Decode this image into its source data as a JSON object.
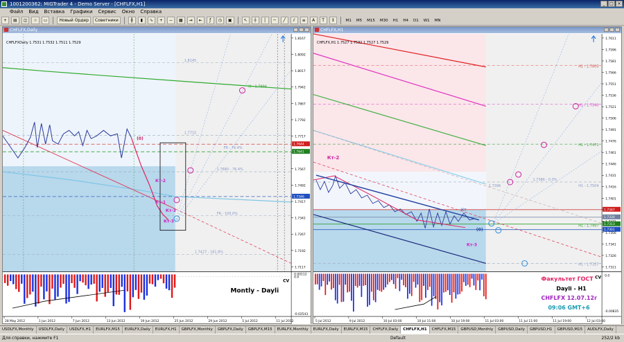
{
  "app": {
    "title": "1001200362: MIGTrader 4 - Demo Server - [CHFLFX,H1]"
  },
  "menu": [
    "Файл",
    "Вид",
    "Вставка",
    "Графики",
    "Сервис",
    "Окно",
    "Справка"
  ],
  "toolbar": {
    "new_order": "Новый Ордер",
    "advisors": "Советники",
    "timeframes": [
      "M1",
      "M5",
      "M15",
      "M30",
      "H1",
      "H4",
      "D1",
      "W1",
      "MN"
    ]
  },
  "left_chart": {
    "window_title": "CHFLFX,Daily",
    "ohlc": "CHFLFXDaily 1.7531 1.7532 1.7511 1.7529",
    "price_ticks": [
      "1.8167",
      "1.8092",
      "1.8017",
      "1.7942",
      "1.7867",
      "1.7792",
      "1.7717",
      "1.7642",
      "1.7567",
      "1.7492",
      "1.7417",
      "1.7342",
      "1.7267",
      "1.7192",
      "1.7117"
    ],
    "indicator_ticks": [
      "0.00112",
      "0.0",
      "-0.02543"
    ],
    "date_ticks": [
      "28 May 2012",
      "1 Jun 2012",
      "7 Jun 2012",
      "13 Jun 2012",
      "19 Jun 2012",
      "25 Jun 2012",
      "29 Jun 2012",
      "5 Jul 2012",
      "11 Jul 2012"
    ],
    "labels": {
      "kt2": "Кт-2",
      "kt1": "Кт-1",
      "kt3": "Кт-3",
      "kt3b": "Кт-3",
      "zero": "(0)",
      "panel_text": "Montly - Dayli",
      "cv": "CV"
    },
    "level_labels": [
      "1.8145",
      "1.7715",
      "FR - 76.4%",
      "1.7680 - 76.4%",
      "FR - 100.0%",
      "1.7427 - 161.8%",
      "HI - 1.7894"
    ],
    "price_tags": [
      {
        "value": "1.7644",
        "color": "#d02020"
      },
      {
        "value": "1.7641",
        "color": "#208020"
      },
      {
        "value": "1.7346",
        "color": "#2050c0"
      }
    ]
  },
  "right_chart": {
    "window_title": "CHFLFX,H1",
    "ohlc": "CHFLFX,H1 1.7527 1.7532 1.7527 1.7529",
    "price_ticks": [
      "1.7611",
      "1.7596",
      "1.7581",
      "1.7566",
      "1.7551",
      "1.7536",
      "1.7521",
      "1.7506",
      "1.7491",
      "1.7476",
      "1.7461",
      "1.7446",
      "1.7431",
      "1.7416",
      "1.7401",
      "1.7386",
      "1.7371",
      "1.7356",
      "1.7341",
      "1.7326",
      "1.7311"
    ],
    "indicator_ticks": [
      "0.0",
      "-0.00835"
    ],
    "date_ticks": [
      "5 Jul 2012",
      "9 Jul 2012",
      "10 Jul 03:00",
      "10 Jul 11:00",
      "10 Jul 19:00",
      "11 Jul 03:00",
      "11 Jul 11:00",
      "11 Jul 19:00",
      "12 Jul 03:00"
    ],
    "labels": {
      "kt2": "Кт-2",
      "kt3": "Кт-3",
      "kt": "Кт",
      "zero": "(0)",
      "cv": "CV"
    },
    "level_labels": [
      "H1 - 1.7605",
      "H1 - 1.7540",
      "H1 - 1.7471",
      "1.7386 - 0.0%",
      "H1 - 1.7504",
      "H1 - 1.7337",
      "H1 - 1.7497",
      "1.7396"
    ],
    "price_tags": [
      {
        "value": "1.7347",
        "color": "#d02020"
      },
      {
        "value": "1.7330",
        "color": "#7080a0"
      },
      {
        "value": "1.7313",
        "color": "#208020"
      },
      {
        "value": "1.7301",
        "color": "#2050c0"
      }
    ],
    "info": {
      "line1": "Факультет ГОСТ",
      "line2": "Dayli - H1",
      "line3": "CHFLFX 12.07.12г",
      "line4": "09:06 GMT+6"
    }
  },
  "tabs": [
    "USDLFX,Monthly",
    "USDLFX,Daily",
    "USDLFX,H1",
    "EURLFX,M15",
    "EURLFX,Daily",
    "EURLFX,H1",
    "GBPLFX,Monthly",
    "GBPLFX,Daily",
    "GBPLFX,M15",
    "EURLFX,Monthly",
    "EURLFX,Daily",
    "EURLFX,M15",
    "CHFLFX,Daily",
    "CHFLFX,H1",
    "CHFLFX,M15",
    "GBPUSD,Monthly",
    "GBPUSD,Daily",
    "GBPUSD,H1",
    "GBPUSD,M15",
    "AUDLFX,Daily"
  ],
  "active_tab": "CHFLFX,H1",
  "status": {
    "left": "Для справки, нажмите F1",
    "middle": "Default",
    "right": "252/2 kb"
  }
}
